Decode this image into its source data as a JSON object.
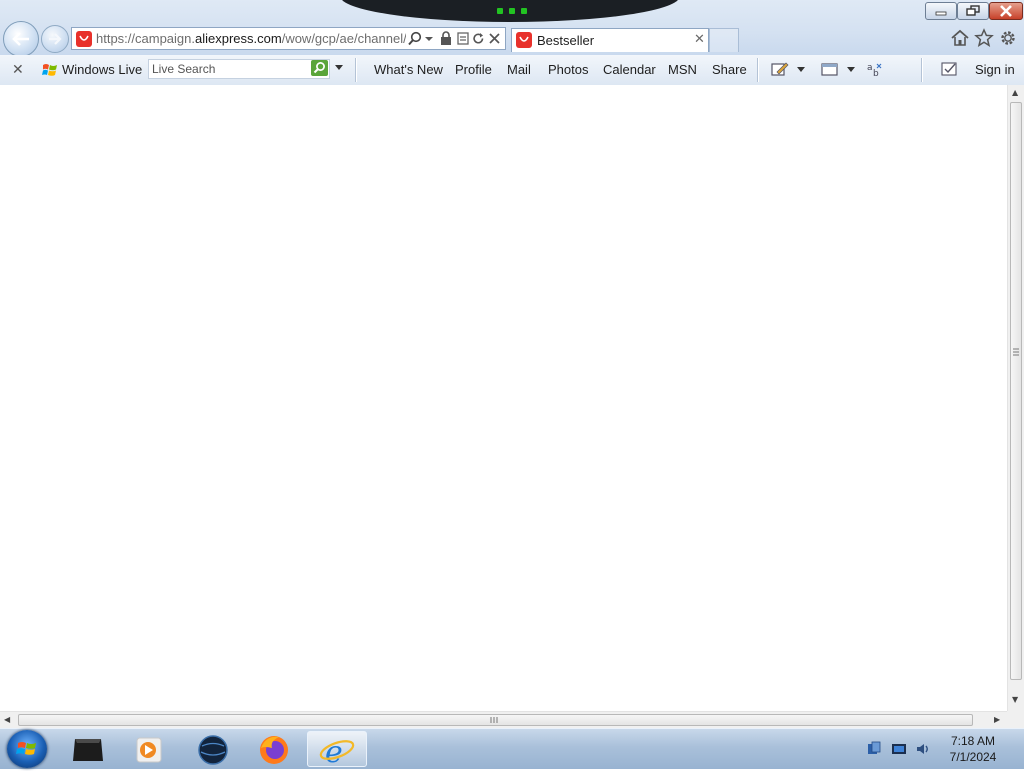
{
  "browser": {
    "address": {
      "url_prefix": "https://campaign.",
      "url_domain": "aliexpress.com",
      "url_rest": "/wow/gcp/ae/channel/ae"
    },
    "tab": {
      "title": "Bestseller",
      "close_glyph": "✕"
    }
  },
  "window_controls": {
    "minimize_icon": "minimize-icon",
    "restore_icon": "restore-icon",
    "close_icon": "close-icon"
  },
  "windows_live_toolbar": {
    "close_glyph": "✕",
    "brand": "Windows Live",
    "search_placeholder": "Live Search",
    "links": [
      "What's New",
      "Profile",
      "Mail",
      "Photos",
      "Calendar",
      "MSN",
      "Share"
    ],
    "sign_in": "Sign in"
  },
  "taskbar": {
    "clock": {
      "time": "7:18 AM",
      "date": "7/1/2024"
    },
    "pinned": [
      "media-player-icon",
      "video-player-icon",
      "globe-icon",
      "firefox-icon",
      "internet-explorer-icon"
    ],
    "active": "internet-explorer-icon"
  },
  "colors": {
    "favicon": "#e8312b",
    "chrome": "#d4e1f1",
    "taskbar": "#a9c0da",
    "search_button": "#5aa53a"
  }
}
